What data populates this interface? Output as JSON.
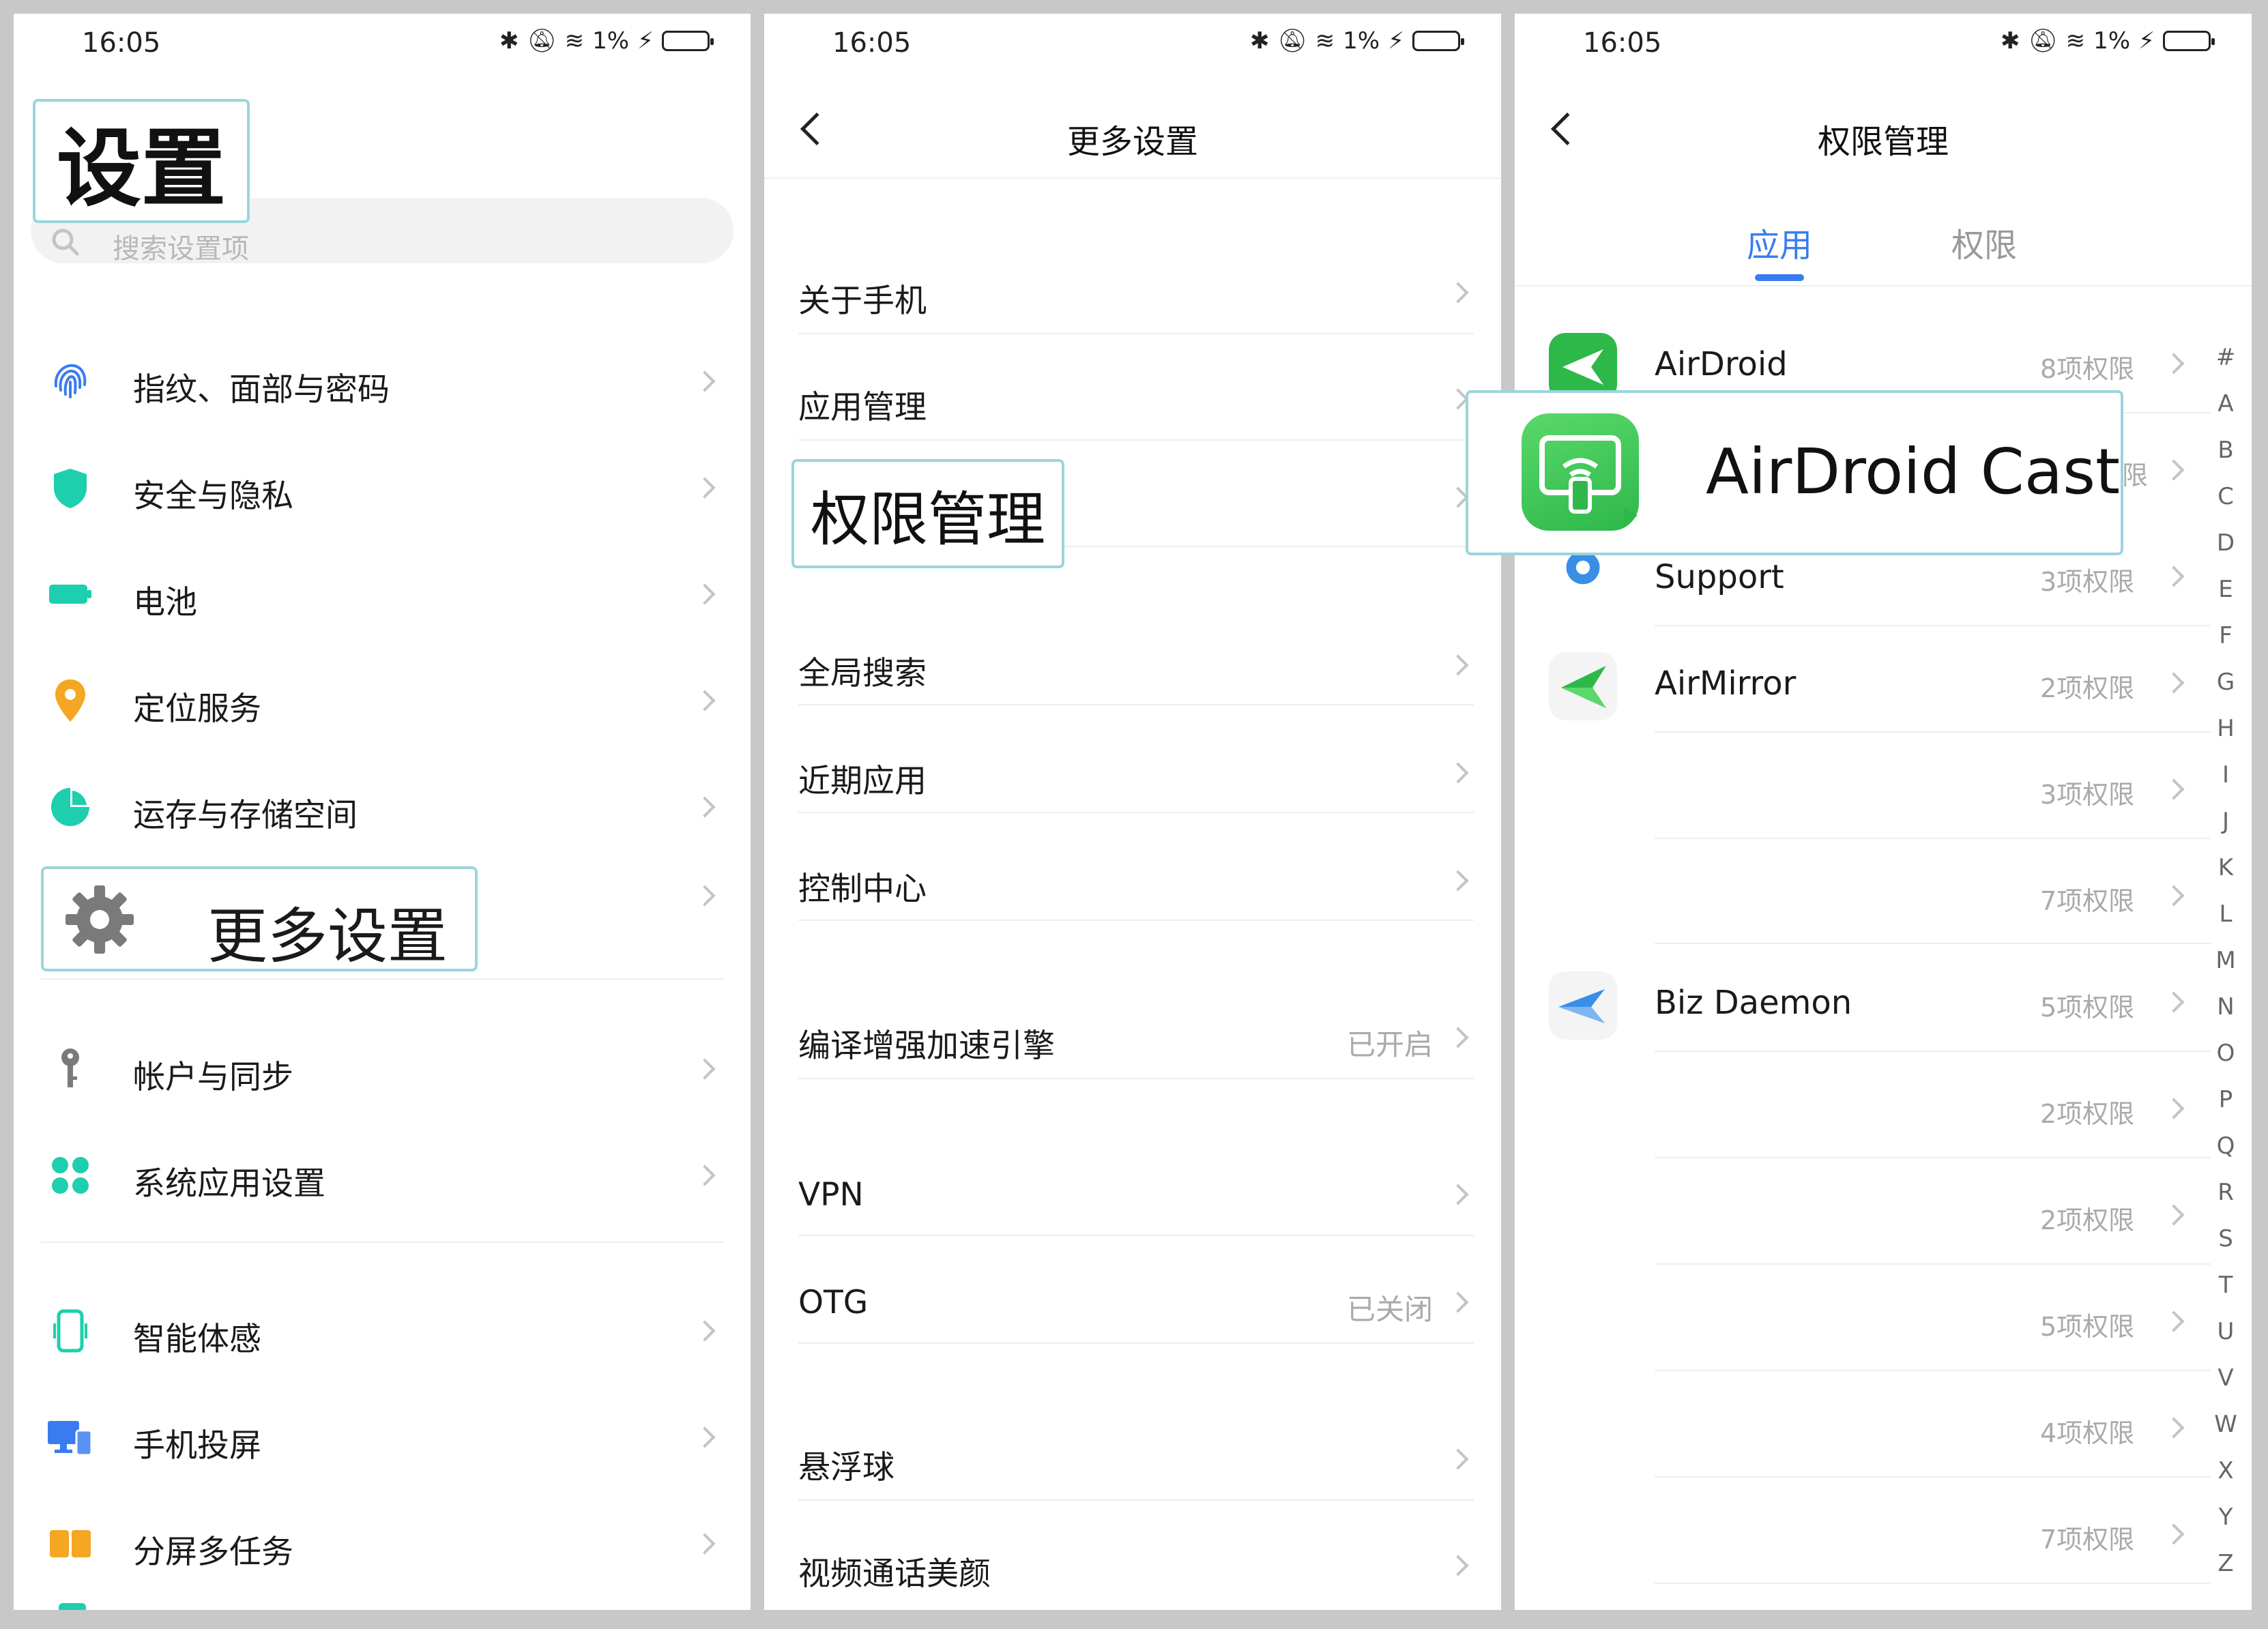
{
  "status_bar": {
    "time": "16:05",
    "battery": "1%"
  },
  "panel1": {
    "title": "设置",
    "search_placeholder": "搜索设置项",
    "items": [
      {
        "label": "指纹、面部与密码",
        "icon": "fingerprint-icon"
      },
      {
        "label": "安全与隐私",
        "icon": "shield-icon"
      },
      {
        "label": "电池",
        "icon": "battery-icon"
      },
      {
        "label": "定位服务",
        "icon": "location-pin-icon"
      },
      {
        "label": "运存与存储空间",
        "icon": "pie-chart-icon"
      },
      {
        "label": "帐户与同步",
        "icon": "key-icon"
      },
      {
        "label": "系统应用设置",
        "icon": "apps-grid-icon"
      },
      {
        "label": "智能体感",
        "icon": "phone-motion-icon"
      },
      {
        "label": "手机投屏",
        "icon": "screen-cast-icon"
      },
      {
        "label": "分屏多任务",
        "icon": "split-screen-icon"
      }
    ],
    "highlight_label": "更多设置"
  },
  "panel2": {
    "title": "更多设置",
    "items": [
      {
        "label": "关于手机",
        "value": ""
      },
      {
        "label": "应用管理",
        "value": ""
      },
      {
        "label": "全局搜索",
        "value": ""
      },
      {
        "label": "近期应用",
        "value": ""
      },
      {
        "label": "控制中心",
        "value": ""
      },
      {
        "label": "编译增强加速引擎",
        "value": "已开启"
      },
      {
        "label": "VPN",
        "value": ""
      },
      {
        "label": "OTG",
        "value": "已关闭"
      },
      {
        "label": "悬浮球",
        "value": ""
      },
      {
        "label": "视频通话美颜",
        "value": ""
      }
    ],
    "highlight_label": "权限管理"
  },
  "panel3": {
    "title": "权限管理",
    "tabs": [
      "应用",
      "权限"
    ],
    "apps": [
      {
        "name": "AirDroid",
        "perm": "8项权限"
      },
      {
        "name": "",
        "perm": "限"
      },
      {
        "name": "Support",
        "perm": "3项权限"
      },
      {
        "name": "AirMirror",
        "perm": "2项权限"
      },
      {
        "name": "",
        "perm": "3项权限"
      },
      {
        "name": "",
        "perm": "7项权限"
      },
      {
        "name": "Biz Daemon",
        "perm": "5项权限"
      },
      {
        "name": "",
        "perm": "2项权限"
      },
      {
        "name": "",
        "perm": "2项权限"
      },
      {
        "name": "",
        "perm": "5项权限"
      },
      {
        "name": "",
        "perm": "4项权限"
      },
      {
        "name": "",
        "perm": "7项权限"
      }
    ],
    "alpha_index": [
      "#",
      "A",
      "B",
      "C",
      "D",
      "E",
      "F",
      "G",
      "H",
      "I",
      "J",
      "K",
      "L",
      "M",
      "N",
      "O",
      "P",
      "Q",
      "R",
      "S",
      "T",
      "U",
      "V",
      "W",
      "X",
      "Y",
      "Z"
    ],
    "highlight_app": "AirDroid Cast"
  },
  "colors": {
    "accent_blue": "#3a7cf0",
    "highlight_border": "#9ad5dc",
    "icon_teal": "#1dcfae",
    "airdroid_green": "#2eb84a"
  }
}
